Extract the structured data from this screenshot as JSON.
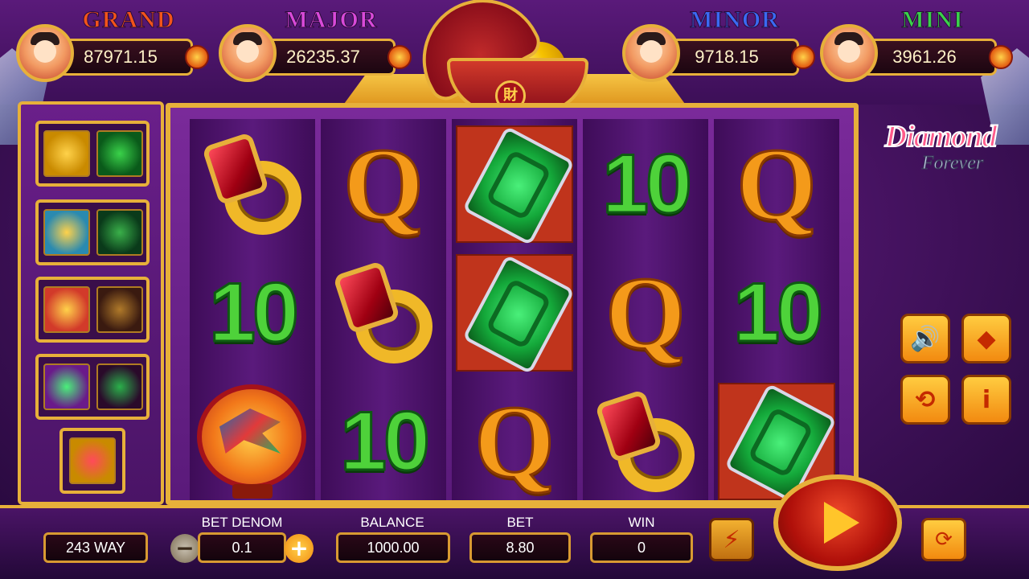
{
  "jackpots": [
    {
      "title": "GRAND",
      "value": "87971.15",
      "color": "#f2541a",
      "avatar": "boy-with-gold-ingot"
    },
    {
      "title": "MAJOR",
      "value": "26235.37",
      "color": "#d84ad8",
      "avatar": "girl-with-lucky-cat"
    },
    {
      "title": "MINOR",
      "value": "9718.15",
      "color": "#3a6af2",
      "avatar": "boy-with-coin"
    },
    {
      "title": "MINI",
      "value": "3961.26",
      "color": "#3ad24a",
      "avatar": "girl-with-red-envelope"
    }
  ],
  "bowl_glyph": "財",
  "logo": {
    "line1": "Diamond",
    "line2": "Forever"
  },
  "paytable_pairs": [
    {
      "left": "gold-dragon-icon",
      "right": "green-dragon-icon"
    },
    {
      "left": "gold-turtle-icon",
      "right": "green-turtle-icon"
    },
    {
      "left": "gold-phoenix-icon",
      "right": "dark-phoenix-icon"
    },
    {
      "left": "jade-pendant-icon",
      "right": "dark-jade-pendant-icon"
    }
  ],
  "paytable_single": "ruby-ring-icon",
  "reels": [
    [
      "ruby-ring",
      "10",
      "phoenix-mirror"
    ],
    [
      "Q",
      "ruby-ring",
      "10"
    ],
    [
      "jade-pendant",
      "jade-pendant",
      "Q"
    ],
    [
      "10",
      "Q",
      "ruby-ring"
    ],
    [
      "Q",
      "10",
      "jade-pendant"
    ]
  ],
  "controls": {
    "ways": "243 WAY",
    "bet_denom_label": "BET DENOM",
    "bet_denom_value": "0.1",
    "minus": "−",
    "plus": "+",
    "balance_label": "BALANCE",
    "balance_value": "1000.00",
    "bet_label": "BET",
    "bet_value": "8.80",
    "win_label": "WIN",
    "win_value": "0"
  },
  "side_buttons": {
    "sound": "🔊",
    "fullscreen": "◆",
    "history": "⟲",
    "info": "i"
  },
  "turbo_icon": "⚡",
  "autoplay_icon": "⟳",
  "colors": {
    "accent_gold": "#e7b03a",
    "q_orange": "#f49a1a",
    "ten_green": "#4ed23a",
    "background_purple": "#4a1466"
  }
}
